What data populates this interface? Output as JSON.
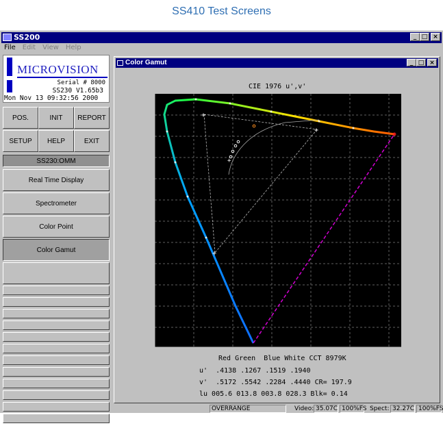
{
  "page_title": "SS410 Test Screens",
  "window": {
    "title": "SS200",
    "buttons": [
      "_",
      "□",
      "×"
    ]
  },
  "menu": [
    "File",
    "Edit",
    "View",
    "Help"
  ],
  "logo": {
    "brand": "MICROVISION",
    "serial": "Serial # 8000",
    "version": "SS230 V1.65b3",
    "datetime": "Mon Nov 13 09:32:56 2000"
  },
  "grid_buttons": [
    "POS.",
    "INIT",
    "REPORT",
    "SETUP",
    "HELP",
    "EXIT"
  ],
  "model_label": "SS230:OMM",
  "menu_buttons": [
    "Real Time Display",
    "Spectrometer",
    "Color Point",
    "Color Gamut"
  ],
  "selected_menu_button": "Color Gamut",
  "child_window": {
    "title": "Color Gamut",
    "buttons": [
      "_",
      "□",
      "×"
    ]
  },
  "plot": {
    "title": "CIE 1976 u',v'",
    "table_header": "Red Green  Blue White CCT 8979K",
    "row_u": "u'  .4138 .1267 .1519 .1940",
    "row_v": "v'  .5172 .5542 .2284 .4440 CR= 197.9",
    "row_lu": "lu 005.6 013.8 003.8 028.3 Blk= 0.14"
  },
  "colors": {
    "titlebar": "#000080",
    "plot_bg": "#000000",
    "window_bg": "#c0c0c0",
    "page_title": "#2f6fb3"
  },
  "statusbar": {
    "overrange": "OVERRANGE",
    "video_label": "Video:",
    "video_value": "35.07C",
    "video_pct": "100%FS",
    "spect_label": "Spect:",
    "spect_value": "32.27C",
    "spect_pct": "100%FS"
  }
}
